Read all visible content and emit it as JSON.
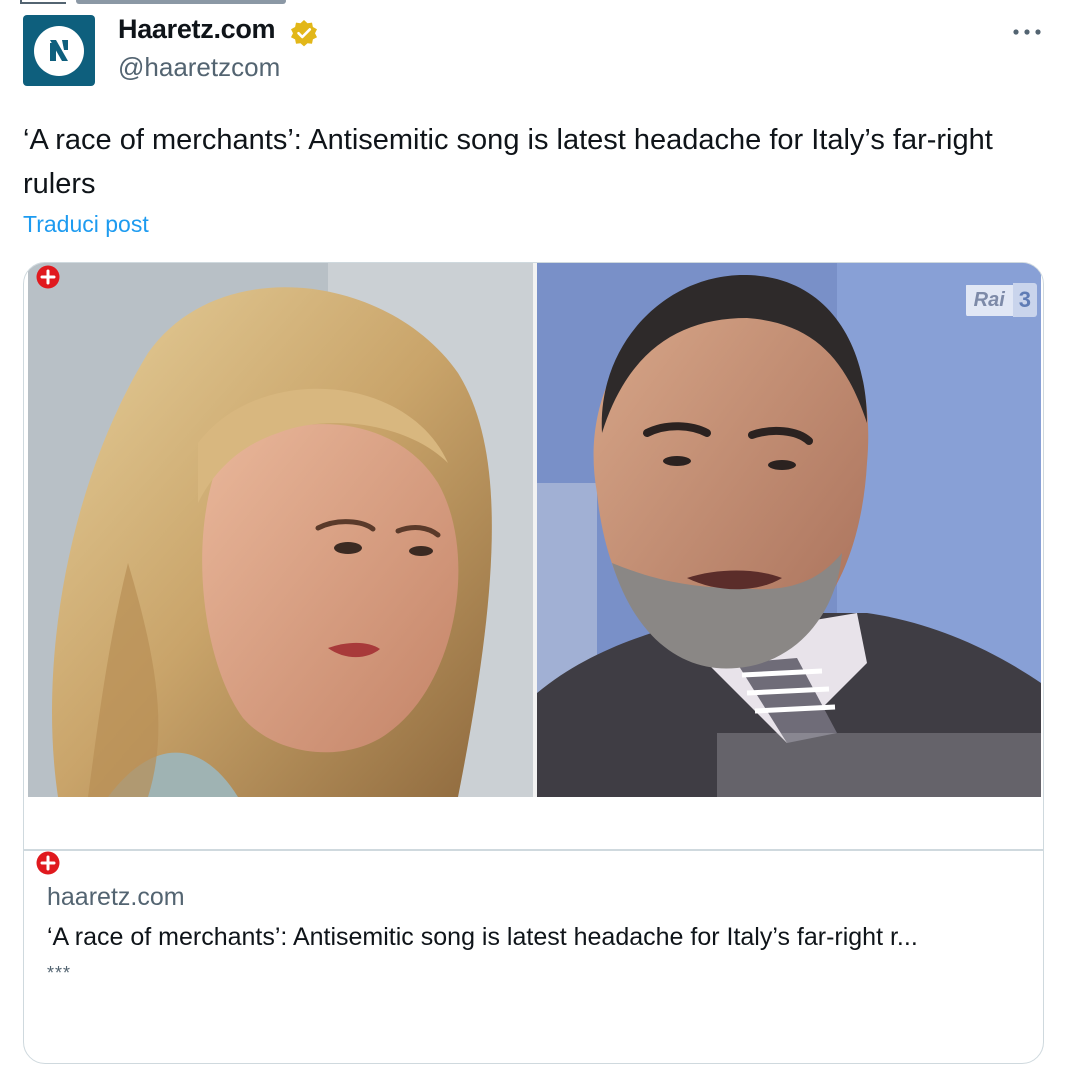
{
  "post": {
    "author_name": "Haaretz.com",
    "handle": "@haaretzcom",
    "text": "‘A race of merchants’: Antisemitic song is latest headache for Italy’s far-right rulers",
    "translate_label": "Traduci post"
  },
  "card": {
    "domain": "haaretz.com",
    "title": "‘A race of merchants’: Antisemitic song is latest headache for Italy’s far-right r...",
    "description": "***",
    "image_watermark": "Rai 3"
  },
  "icons": {
    "avatar": "haaretz-logo-icon",
    "verified": "verified-badge-icon",
    "more": "more-options-icon",
    "plus": "plus-badge-icon"
  },
  "colors": {
    "link": "#1d9bf0",
    "text": "#0f1419",
    "secondary": "#536471",
    "verified_gold": "#e2b719",
    "avatar_bg": "#0e5f7d",
    "badge_red": "#e0191e",
    "border": "#cfd9de"
  }
}
